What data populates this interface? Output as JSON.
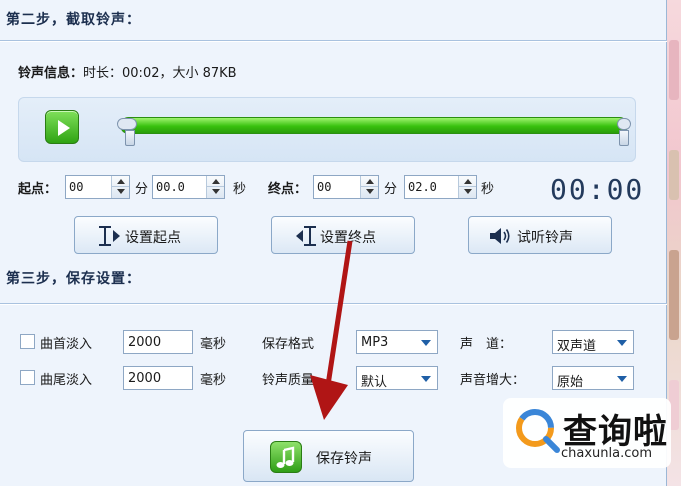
{
  "step2": {
    "title": "第二步，截取铃声："
  },
  "info": {
    "label": "铃声信息：",
    "value": "时长：00:02，大小 87KB"
  },
  "start": {
    "label": "起点：",
    "min_value": "00",
    "min_unit": "分",
    "sec_value": "00.0",
    "sec_unit": "秒"
  },
  "end": {
    "label": "终点：",
    "min_value": "00",
    "min_unit": "分",
    "sec_value": "02.0",
    "sec_unit": "秒"
  },
  "timer": "00:00",
  "buttons": {
    "set_start": "设置起点",
    "set_end": "设置终点",
    "preview": "试听铃声",
    "save": "保存铃声"
  },
  "step3": {
    "title": "第三步，保存设置："
  },
  "settings": {
    "fade_in_label": "曲首淡入",
    "fade_in_value": "2000",
    "fade_out_label": "曲尾淡入",
    "fade_out_value": "2000",
    "ms_unit": "毫秒",
    "format_label": "保存格式",
    "format_value": "MP3",
    "quality_label": "铃声质量",
    "quality_value": "默认",
    "channel_label": "声　道：",
    "channel_value": "双声道",
    "gain_label": "声音增大：",
    "gain_value": "原始"
  },
  "watermark": {
    "name": "查询啦",
    "domain": "chaxunla.com"
  },
  "colors": {
    "accent_green": "#38c10e",
    "panel_bg": "#eef4fc",
    "arrow_red": "#b01515",
    "title_text": "#1c2f4f"
  },
  "icons": [
    "play-icon",
    "ibeam-right-icon",
    "ibeam-left-icon",
    "speaker-icon",
    "music-note-icon",
    "search-logo-icon"
  ]
}
